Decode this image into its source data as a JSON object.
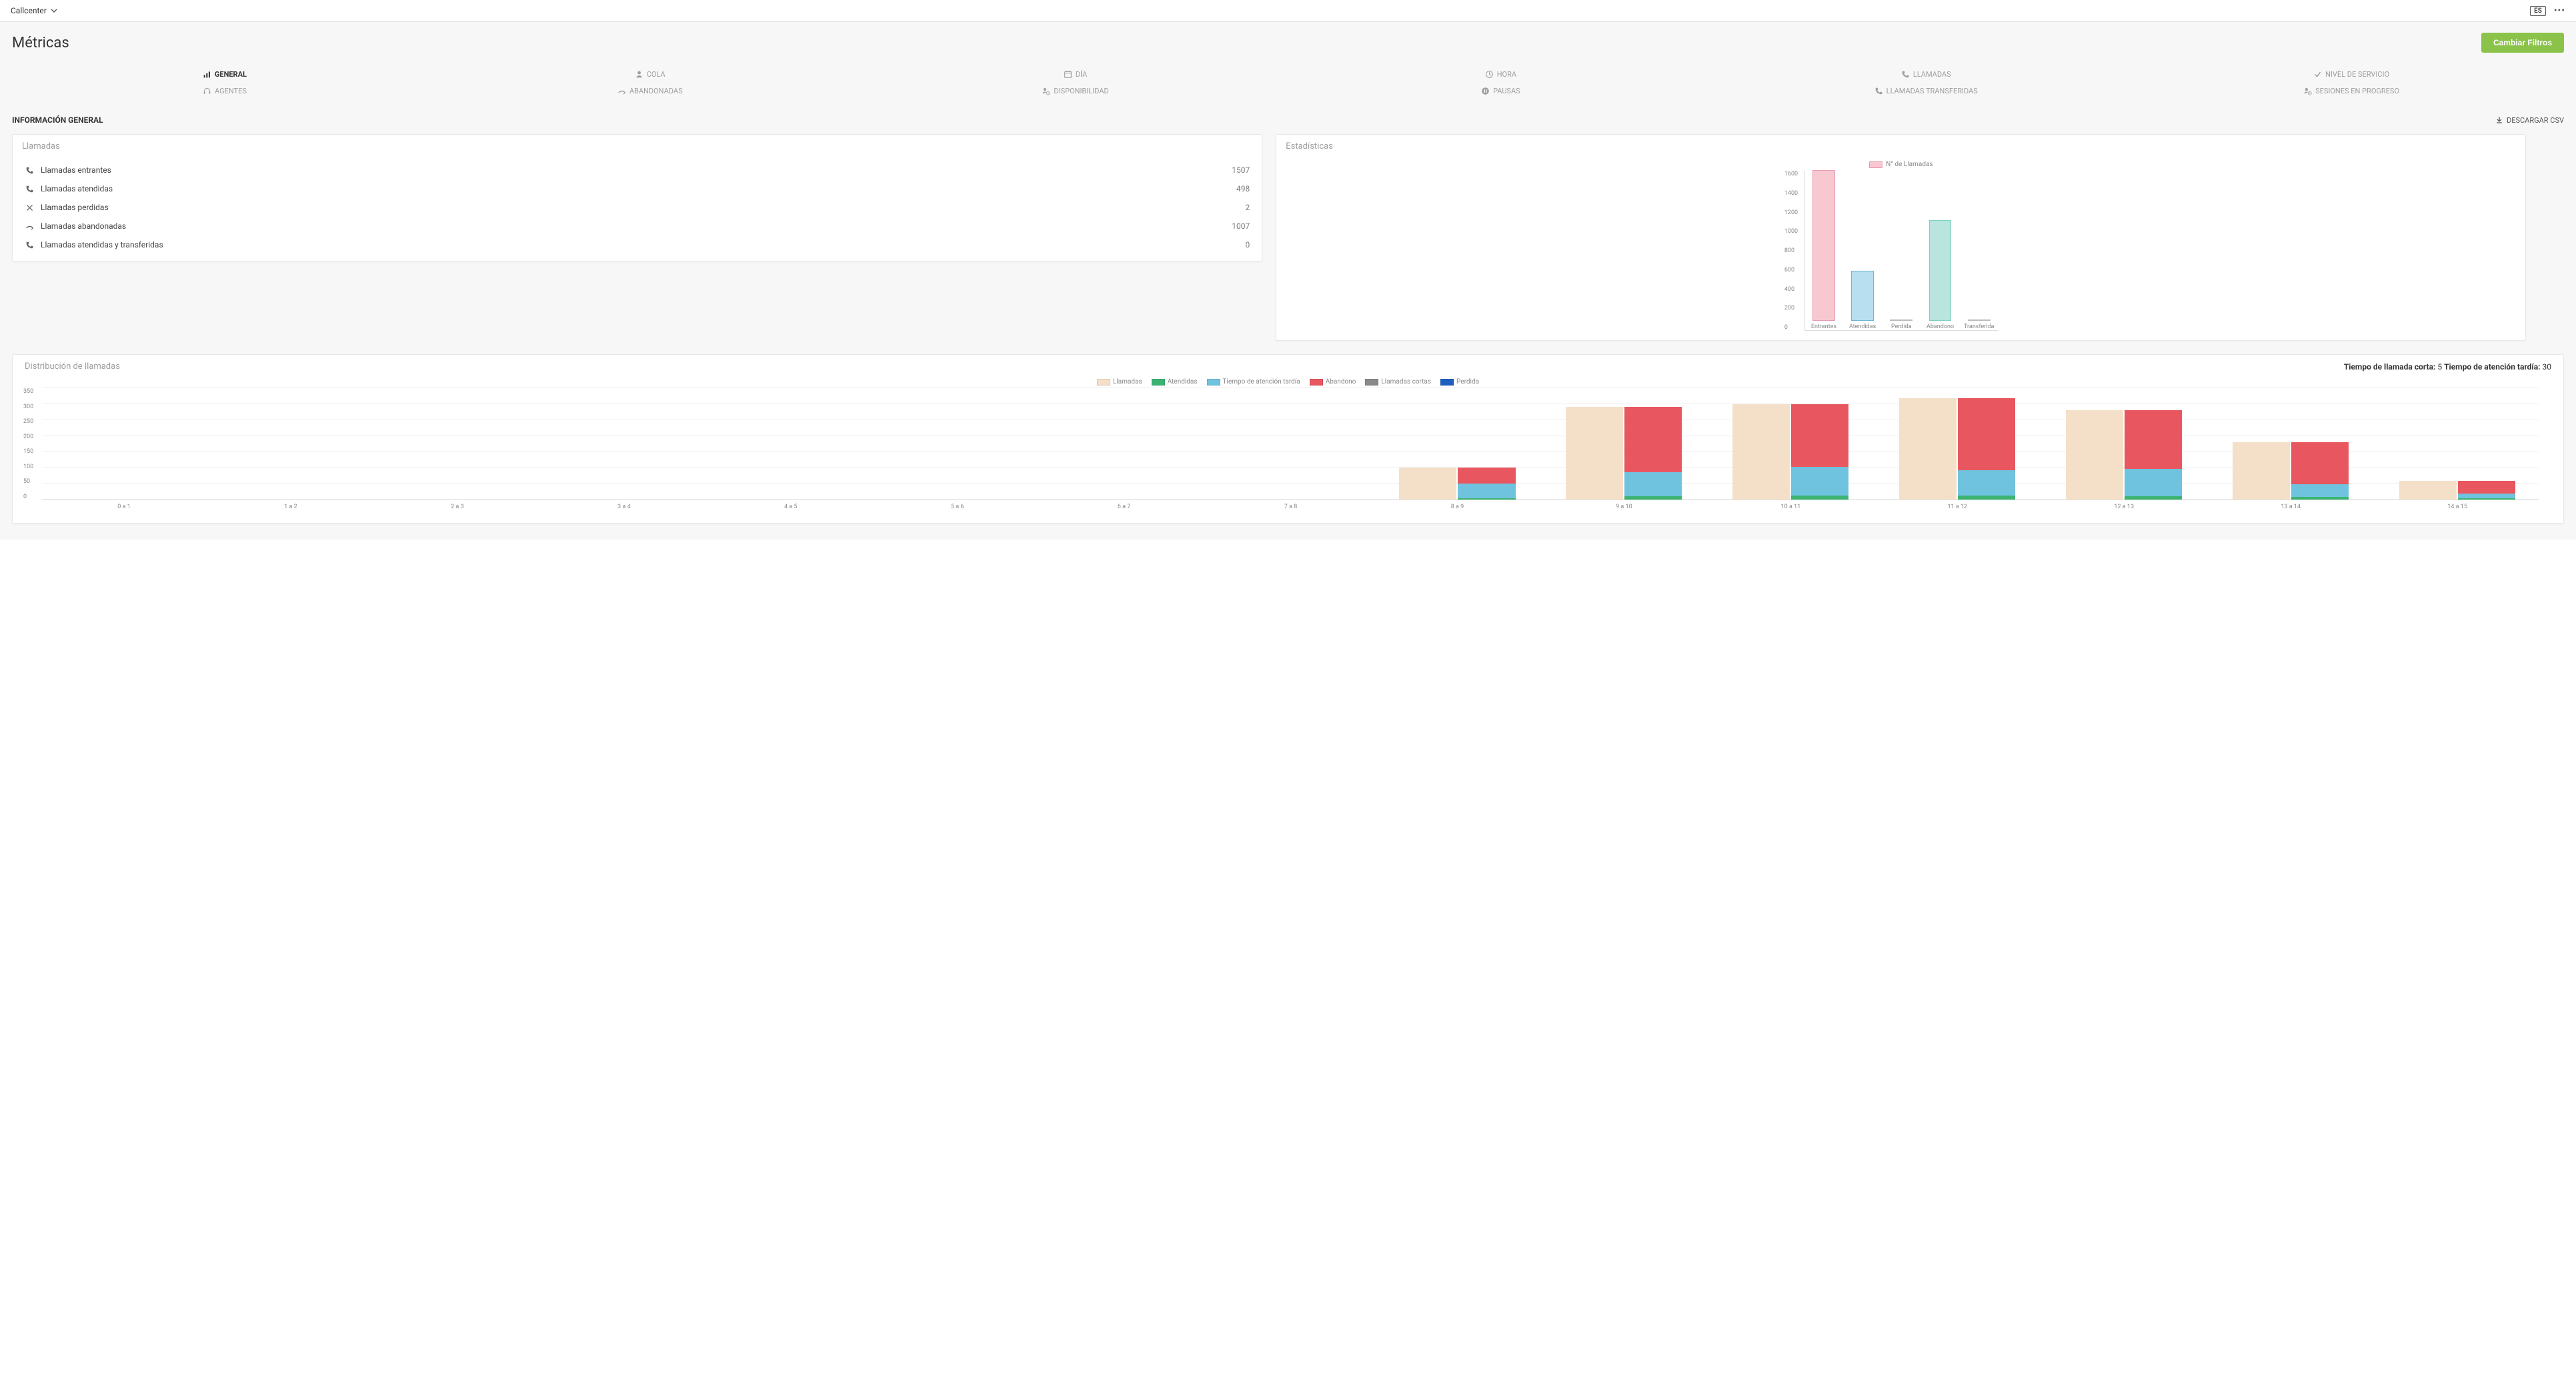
{
  "topbar": {
    "app_label": "Callcenter",
    "language": "ES"
  },
  "page": {
    "title": "Métricas",
    "filter_button": "Cambiar Filtros"
  },
  "tabs": [
    {
      "label": "General",
      "active": true,
      "icon": "bars"
    },
    {
      "label": "Cola",
      "active": false,
      "icon": "person"
    },
    {
      "label": "Día",
      "active": false,
      "icon": "calendar"
    },
    {
      "label": "Hora",
      "active": false,
      "icon": "clock"
    },
    {
      "label": "Llamadas",
      "active": false,
      "icon": "phone"
    },
    {
      "label": "Nivel de Servicio",
      "active": false,
      "icon": "check"
    },
    {
      "label": "Agentes",
      "active": false,
      "icon": "headset"
    },
    {
      "label": "Abandonadas",
      "active": false,
      "icon": "missed"
    },
    {
      "label": "Disponibilidad",
      "active": false,
      "icon": "person-clock"
    },
    {
      "label": "Pausas",
      "active": false,
      "icon": "pause"
    },
    {
      "label": "Llamadas Transferidas",
      "active": false,
      "icon": "phone-fwd"
    },
    {
      "label": "Sesiones en Progreso",
      "active": false,
      "icon": "person-clock"
    }
  ],
  "section": {
    "title": "Información General",
    "download": "Descargar CSV"
  },
  "llamadas_card": {
    "title": "Llamadas",
    "rows": [
      {
        "label": "Llamadas entrantes",
        "value": "1507",
        "icon": "phone-in"
      },
      {
        "label": "Llamadas atendidas",
        "value": "498",
        "icon": "phone-in"
      },
      {
        "label": "Llamadas perdidas",
        "value": "2",
        "icon": "phone-miss"
      },
      {
        "label": "Llamadas abandonadas",
        "value": "1007",
        "icon": "missed"
      },
      {
        "label": "Llamadas atendidas y transferidas",
        "value": "0",
        "icon": "phone-fwd"
      }
    ]
  },
  "estad_card": {
    "title": "Estadísticas",
    "legend": "N° de Llamadas"
  },
  "dist_card": {
    "title": "Distribución de llamadas",
    "short_label": "Tiempo de llamada corta:",
    "short_value": "5",
    "late_label": "Tiempo de atención tardía:",
    "late_value": "30",
    "legend": [
      "Llamadas",
      "Atendidas",
      "Tiempo de atención tardía",
      "Abandono",
      "Llamadas cortas",
      "Perdida"
    ]
  },
  "colors": {
    "llamadas": "#f4e0c9",
    "atendidas": "#3cb371",
    "tardia": "#6fc3df",
    "abandono": "#e8575f",
    "cortas": "#8a8a8a",
    "perdida": "#1f5fbf",
    "stat_entrantes": "#f8c8d0",
    "stat_entrantes_border": "#e89bb0",
    "stat_atendidas": "#b8dff0",
    "stat_abandono": "#b8e6de"
  },
  "chart_data": [
    {
      "type": "bar",
      "title": "Estadísticas",
      "categories": [
        "Entrantes",
        "Atendidas",
        "Perdida",
        "Abandono",
        "Transferida"
      ],
      "values": [
        1507,
        498,
        2,
        1007,
        0
      ],
      "ylim": [
        0,
        1600
      ],
      "yticks": [
        0,
        200,
        400,
        600,
        800,
        1000,
        1200,
        1400,
        1600
      ],
      "legend": [
        "N° de Llamadas"
      ]
    },
    {
      "type": "bar",
      "title": "Distribución de llamadas",
      "categories": [
        "0 a 1",
        "1 a 2",
        "2 a 3",
        "3 a 4",
        "4 a 5",
        "5 a 6",
        "6 a 7",
        "7 a 8",
        "8 a 9",
        "9 a 10",
        "10 a 11",
        "11 a 12",
        "12 a 13",
        "13 a 14",
        "14 a 15"
      ],
      "series": [
        {
          "name": "Llamadas",
          "values": [
            0,
            0,
            0,
            0,
            0,
            0,
            0,
            0,
            100,
            290,
            298,
            317,
            280,
            180,
            58
          ]
        },
        {
          "name": "Atendidas",
          "values": [
            0,
            0,
            0,
            0,
            0,
            0,
            0,
            0,
            5,
            10,
            12,
            12,
            10,
            8,
            4
          ]
        },
        {
          "name": "Tiempo de atención tardía",
          "values": [
            0,
            0,
            0,
            0,
            0,
            0,
            0,
            0,
            45,
            75,
            90,
            80,
            85,
            40,
            15
          ]
        },
        {
          "name": "Abandono",
          "values": [
            0,
            0,
            0,
            0,
            0,
            0,
            0,
            0,
            50,
            205,
            195,
            225,
            185,
            132,
            40
          ]
        },
        {
          "name": "Llamadas cortas",
          "values": [
            0,
            0,
            0,
            0,
            0,
            0,
            0,
            0,
            0,
            0,
            0,
            0,
            0,
            0,
            0
          ]
        },
        {
          "name": "Perdida",
          "values": [
            0,
            0,
            0,
            0,
            0,
            0,
            0,
            0,
            0,
            0,
            0,
            0,
            0,
            0,
            0
          ]
        }
      ],
      "ylim": [
        0,
        350
      ],
      "yticks": [
        0,
        50,
        100,
        150,
        200,
        250,
        300,
        350
      ]
    }
  ]
}
